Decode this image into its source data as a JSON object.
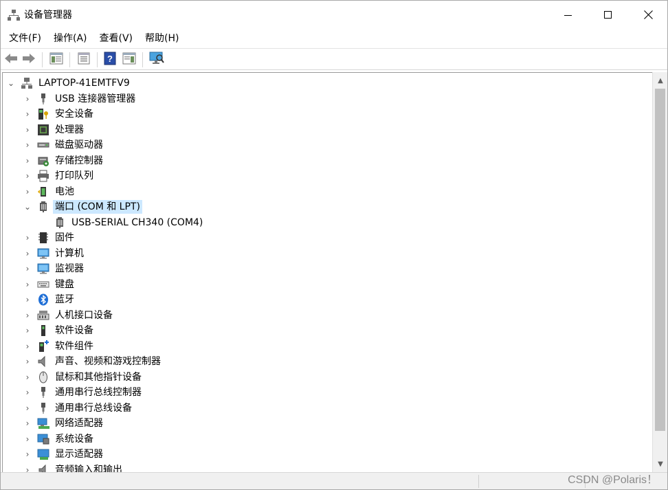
{
  "window": {
    "title": "设备管理器",
    "app_icon": "device-manager-icon",
    "controls": [
      "minimize-icon",
      "maximize-icon",
      "close-icon"
    ]
  },
  "menu": [
    {
      "label": "文件(F)"
    },
    {
      "label": "操作(A)"
    },
    {
      "label": "查看(V)"
    },
    {
      "label": "帮助(H)"
    }
  ],
  "toolbar": {
    "buttons": [
      "back-icon",
      "forward-icon",
      "show-hide-console-tree-icon",
      "properties-icon",
      "help-icon",
      "action-pane-icon",
      "scan-hardware-icon"
    ]
  },
  "tree": {
    "root": {
      "label": "LAPTOP-41EMTFV9",
      "icon": "computer-icon",
      "expanded": true
    },
    "items": [
      {
        "label": "USB 连接器管理器",
        "icon": "usb-plug-icon",
        "expanded": false
      },
      {
        "label": "安全设备",
        "icon": "security-key-icon",
        "expanded": false
      },
      {
        "label": "处理器",
        "icon": "processor-icon",
        "expanded": false
      },
      {
        "label": "磁盘驱动器",
        "icon": "disk-drive-icon",
        "expanded": false
      },
      {
        "label": "存储控制器",
        "icon": "storage-controller-icon",
        "expanded": false
      },
      {
        "label": "打印队列",
        "icon": "printer-icon",
        "expanded": false
      },
      {
        "label": "电池",
        "icon": "battery-icon",
        "expanded": false
      },
      {
        "label": "端口 (COM 和 LPT)",
        "icon": "port-icon",
        "expanded": true,
        "selected": true
      },
      {
        "label": "USB-SERIAL CH340 (COM4)",
        "icon": "port-icon",
        "child": true
      },
      {
        "label": "固件",
        "icon": "firmware-icon",
        "expanded": false
      },
      {
        "label": "计算机",
        "icon": "monitor-icon",
        "expanded": false
      },
      {
        "label": "监视器",
        "icon": "monitor-icon",
        "expanded": false
      },
      {
        "label": "键盘",
        "icon": "keyboard-icon",
        "expanded": false
      },
      {
        "label": "蓝牙",
        "icon": "bluetooth-icon",
        "expanded": false
      },
      {
        "label": "人机接口设备",
        "icon": "hid-icon",
        "expanded": false
      },
      {
        "label": "软件设备",
        "icon": "software-device-icon",
        "expanded": false
      },
      {
        "label": "软件组件",
        "icon": "software-component-icon",
        "expanded": false
      },
      {
        "label": "声音、视频和游戏控制器",
        "icon": "speaker-icon",
        "expanded": false
      },
      {
        "label": "鼠标和其他指针设备",
        "icon": "mouse-icon",
        "expanded": false
      },
      {
        "label": "通用串行总线控制器",
        "icon": "usb-plug-icon",
        "expanded": false
      },
      {
        "label": "通用串行总线设备",
        "icon": "usb-plug-icon",
        "expanded": false
      },
      {
        "label": "网络适配器",
        "icon": "network-adapter-icon",
        "expanded": false
      },
      {
        "label": "系统设备",
        "icon": "system-device-icon",
        "expanded": false
      },
      {
        "label": "显示适配器",
        "icon": "display-adapter-icon",
        "expanded": false
      },
      {
        "label": "音频输入和输出",
        "icon": "audio-io-icon",
        "expanded": false
      }
    ]
  },
  "watermark": "CSDN @Polaris！",
  "colors": {
    "selection": "#cce8ff",
    "window_bg": "#ffffff",
    "status_bg": "#f0f0f0"
  }
}
